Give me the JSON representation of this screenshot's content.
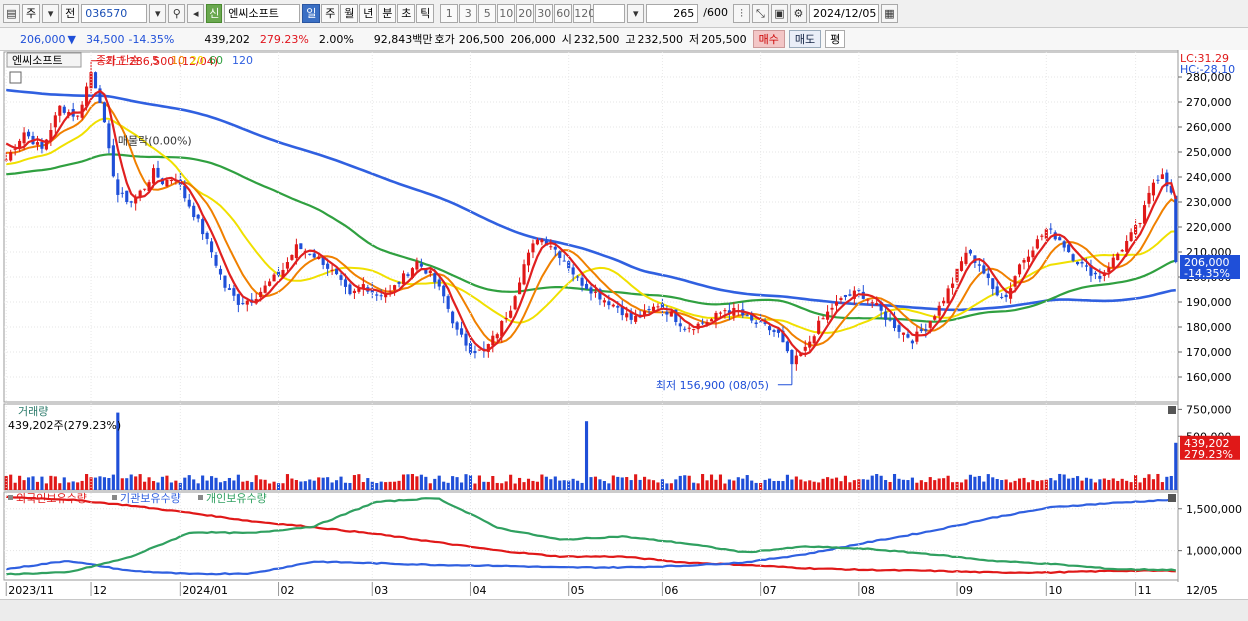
{
  "toolbar": {
    "period_type": "주",
    "prev_label": "전",
    "code": "036570",
    "shin_label": "신",
    "name": "엔씨소프트",
    "periods": [
      "일",
      "주",
      "월",
      "년",
      "분",
      "초",
      "틱"
    ],
    "active_period": "일",
    "intervals": [
      "1",
      "3",
      "5",
      "10",
      "20",
      "30",
      "60",
      "120"
    ],
    "count": "265",
    "count_max": "/600",
    "date": "2024/12/05"
  },
  "info": {
    "price": "206,000",
    "change_arrow": "▼",
    "change": "34,500",
    "change_pct": "-14.35%",
    "volume": "439,202",
    "volume_pct": "279.23%",
    "turnover_pct": "2.00%",
    "amount": "92,843백만",
    "quote_label": "호가",
    "ask": "206,500",
    "bid": "206,000",
    "open_label": "시",
    "open": "232,500",
    "high_label": "고",
    "high": "232,500",
    "low_label": "저",
    "low": "205,500",
    "buy_label": "매수",
    "sell_label": "매도",
    "eval_label": "평"
  },
  "legend": {
    "stock_name": "엔씨소프트",
    "ma_title": "종가 단순",
    "ma_periods": [
      "5",
      "10",
      "20",
      "60",
      "120"
    ],
    "ma_colors": [
      "#e02020",
      "#f08000",
      "#f0e000",
      "#30a040",
      "#3060e0"
    ],
    "lc": "LC:31.29",
    "hc": "HC:-28.10"
  },
  "annotations": {
    "high": "최고 286,500 (12/04)",
    "low": "최저 156,900 (08/05)",
    "lock": "매물락(0.00%)"
  },
  "volume_panel": {
    "title": "거래량",
    "info": "439,202주(279.23%)",
    "current_label": "439,202",
    "current_pct": "279.23%"
  },
  "holdings_panel": {
    "series_names": [
      "외국인보유수량",
      "기관보유수량",
      "개인보유수량"
    ],
    "series_colors": [
      "#e01818",
      "#3060e0",
      "#30a060"
    ]
  },
  "price_axis": {
    "current_label": "206,000",
    "current_pct": "-14.35%"
  },
  "x_labels": [
    "2023/11",
    "12",
    "2024/01",
    "02",
    "03",
    "04",
    "05",
    "06",
    "07",
    "08",
    "09",
    "10",
    "11",
    "12",
    "12/05"
  ],
  "chart_data": [
    {
      "type": "candlestick",
      "title": "엔씨소프트",
      "ylim": [
        150000,
        290000
      ],
      "y_ticks": [
        160000,
        170000,
        180000,
        190000,
        200000,
        210000,
        220000,
        230000,
        240000,
        250000,
        260000,
        270000,
        280000
      ],
      "x_months": [
        "2023/11",
        "12",
        "2024/01",
        "02",
        "03",
        "04",
        "05",
        "06",
        "07",
        "08",
        "09",
        "10",
        "11",
        "12"
      ],
      "close_path": [
        [
          0,
          247000
        ],
        [
          4,
          258000
        ],
        [
          8,
          251000
        ],
        [
          12,
          268000
        ],
        [
          16,
          264000
        ],
        [
          19,
          282000
        ],
        [
          21,
          271000
        ],
        [
          23,
          250000
        ],
        [
          25,
          233000
        ],
        [
          28,
          230000
        ],
        [
          31,
          236000
        ],
        [
          33,
          242000
        ],
        [
          35,
          238000
        ],
        [
          38,
          240000
        ],
        [
          40,
          232000
        ],
        [
          43,
          222000
        ],
        [
          46,
          210000
        ],
        [
          49,
          196000
        ],
        [
          52,
          190000
        ],
        [
          55,
          191000
        ],
        [
          58,
          196000
        ],
        [
          62,
          203000
        ],
        [
          65,
          212000
        ],
        [
          68,
          210000
        ],
        [
          71,
          206000
        ],
        [
          74,
          200000
        ],
        [
          77,
          192000
        ],
        [
          80,
          197000
        ],
        [
          83,
          193000
        ],
        [
          86,
          194000
        ],
        [
          89,
          200000
        ],
        [
          92,
          206000
        ],
        [
          95,
          201000
        ],
        [
          98,
          192000
        ],
        [
          101,
          178000
        ],
        [
          104,
          171000
        ],
        [
          107,
          170000
        ],
        [
          110,
          178000
        ],
        [
          113,
          188000
        ],
        [
          116,
          205000
        ],
        [
          119,
          216000
        ],
        [
          122,
          213000
        ],
        [
          125,
          207000
        ],
        [
          128,
          199000
        ],
        [
          131,
          195000
        ],
        [
          134,
          191000
        ],
        [
          137,
          188000
        ],
        [
          140,
          183000
        ],
        [
          143,
          185000
        ],
        [
          146,
          189000
        ],
        [
          149,
          185000
        ],
        [
          152,
          180000
        ],
        [
          155,
          181000
        ],
        [
          158,
          183000
        ],
        [
          161,
          187000
        ],
        [
          164,
          186000
        ],
        [
          167,
          182000
        ],
        [
          170,
          180000
        ],
        [
          173,
          177000
        ],
        [
          176,
          165000
        ],
        [
          179,
          171000
        ],
        [
          182,
          181000
        ],
        [
          185,
          188000
        ],
        [
          188,
          192000
        ],
        [
          191,
          194000
        ],
        [
          194,
          190000
        ],
        [
          197,
          184000
        ],
        [
          200,
          179000
        ],
        [
          203,
          175000
        ],
        [
          206,
          180000
        ],
        [
          209,
          188000
        ],
        [
          212,
          198000
        ],
        [
          215,
          210000
        ],
        [
          218,
          205000
        ],
        [
          221,
          195000
        ],
        [
          224,
          192000
        ],
        [
          227,
          205000
        ],
        [
          230,
          212000
        ],
        [
          233,
          219000
        ],
        [
          236,
          215000
        ],
        [
          239,
          208000
        ],
        [
          242,
          203000
        ],
        [
          245,
          200000
        ],
        [
          248,
          207000
        ],
        [
          251,
          214000
        ],
        [
          254,
          222000
        ],
        [
          257,
          238000
        ],
        [
          259,
          242000
        ],
        [
          261,
          233000
        ],
        [
          262,
          206000
        ]
      ],
      "ma_start_values": {
        "ma5": 255000,
        "ma10": 250000,
        "ma20": 245000,
        "ma60": 241000,
        "ma120": 275000
      },
      "high": {
        "value": 286500,
        "date": "12/04"
      },
      "low": {
        "value": 156900,
        "date": "08/05"
      },
      "last": {
        "open": 232500,
        "high": 232500,
        "low": 205500,
        "close": 206000,
        "change_pct": -14.35
      }
    },
    {
      "type": "bar",
      "title": "거래량",
      "ylim": [
        0,
        800000
      ],
      "y_ticks": [
        500000,
        750000
      ],
      "spikes": [
        {
          "index": 25,
          "value": 720000
        },
        {
          "index": 130,
          "value": 640000
        },
        {
          "index": 262,
          "value": 439202
        }
      ],
      "typical_range": [
        60000,
        150000
      ]
    },
    {
      "type": "line",
      "title": "보유수량",
      "ylim": [
        650000,
        1700000
      ],
      "y_ticks": [
        1000000,
        1500000
      ],
      "series": [
        {
          "name": "외국인보유수량",
          "values": [
            1640000,
            1610000,
            1540000,
            1450000,
            1350000,
            1280000,
            1200000,
            1100000,
            1000000,
            930000,
            930000,
            860000,
            830000,
            790000,
            770000,
            760000,
            740000,
            740000,
            760000,
            760000
          ]
        },
        {
          "name": "기관보유수량",
          "values": [
            780000,
            880000,
            760000,
            720000,
            730000,
            870000,
            850000,
            830000,
            820000,
            800000,
            800000,
            820000,
            860000,
            960000,
            1100000,
            1230000,
            1390000,
            1520000,
            1570000,
            1610000
          ]
        },
        {
          "name": "개인보유수량",
          "values": [
            720000,
            740000,
            920000,
            1220000,
            1210000,
            1290000,
            1580000,
            1630000,
            1270000,
            1130000,
            1170000,
            1090000,
            980000,
            1050000,
            1020000,
            960000,
            880000,
            840000,
            780000,
            770000
          ]
        }
      ]
    }
  ]
}
